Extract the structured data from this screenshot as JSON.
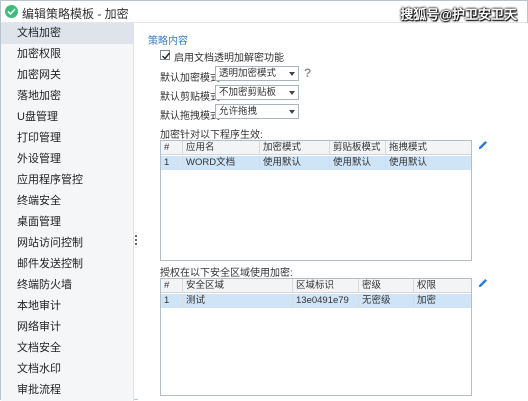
{
  "window": {
    "title": "编辑策略模板 - 加密",
    "watermark": "搜狐号@护卫安卫天"
  },
  "sidebar": {
    "items": [
      {
        "label": "文档加密",
        "active": true
      },
      {
        "label": "加密权限"
      },
      {
        "label": "加密网关"
      },
      {
        "label": "落地加密"
      },
      {
        "label": "U盘管理"
      },
      {
        "label": "打印管理"
      },
      {
        "label": "外设管理"
      },
      {
        "label": "应用程序管控"
      },
      {
        "label": "终端安全"
      },
      {
        "label": "桌面管理"
      },
      {
        "label": "网站访问控制"
      },
      {
        "label": "邮件发送控制"
      },
      {
        "label": "终端防火墙"
      },
      {
        "label": "本地审计"
      },
      {
        "label": "网络审计"
      },
      {
        "label": "文档安全"
      },
      {
        "label": "文档水印"
      },
      {
        "label": "审批流程"
      }
    ]
  },
  "main": {
    "section_title": "策略内容",
    "enable_checkbox": {
      "label": "启用文档透明加解密功能",
      "checked": true
    },
    "fields": [
      {
        "label": "默认加密模式",
        "value": "透明加密模式"
      },
      {
        "label": "默认剪贴模式",
        "value": "不加密剪贴板"
      },
      {
        "label": "默认拖拽模式",
        "value": "允许拖拽"
      }
    ],
    "help_icon": "question-icon",
    "app_table": {
      "caption": "加密针对以下程序生效:",
      "columns": [
        "#",
        "应用名",
        "加密模式",
        "剪贴板模式",
        "拖拽模式"
      ],
      "rows": [
        [
          "1",
          "WORD文档",
          "使用默认",
          "使用默认",
          "使用默认"
        ]
      ]
    },
    "zone_table": {
      "caption": "授权在以下安全区域使用加密:",
      "columns": [
        "#",
        "安全区域",
        "区域标识",
        "密级",
        "权限"
      ],
      "rows": [
        [
          "1",
          "测试",
          "13e0491e79",
          "无密级",
          "加密"
        ]
      ]
    },
    "edit_icon": "pencil-icon"
  },
  "colors": {
    "accent": "#3a7fc1",
    "selected_row": "#cfe4f7",
    "sidebar_bg": "#f4f6f8",
    "app_icon": "#3dbd7d",
    "edit_icon": "#2a7fd4"
  }
}
